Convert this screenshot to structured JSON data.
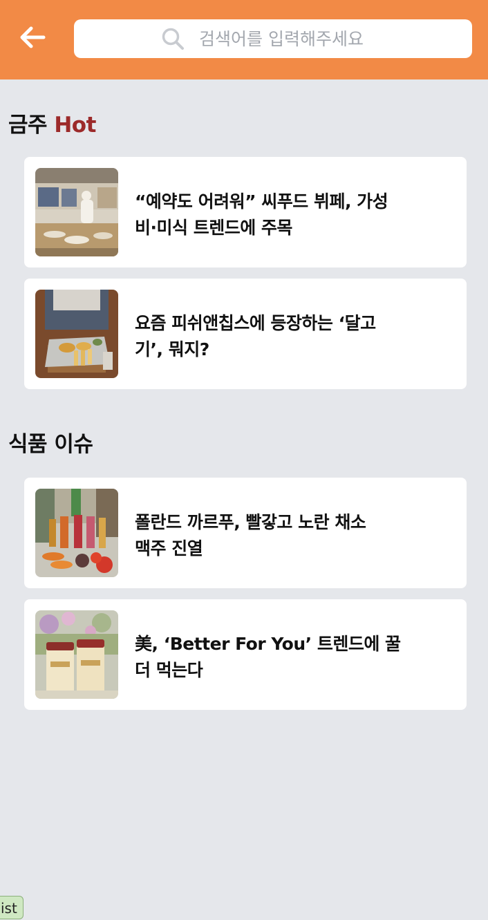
{
  "header": {
    "search_placeholder": "검색어를 입력해주세요",
    "back_icon": "arrow-left-icon",
    "search_icon": "search-icon",
    "background_color": "#f28a46"
  },
  "sections": [
    {
      "title_prefix": "금주 ",
      "title_accent": "Hot",
      "accent_color": "#9c2a2a",
      "articles": [
        {
          "title": "“예약도 어려워” 씨푸드 뷔페, 가성\n비·미식 트렌드에 주목"
        },
        {
          "title": "요즘 피쉬앤칩스에 등장하는 ‘달고\n기’, 뭐지?"
        }
      ]
    },
    {
      "title_prefix": "식품 이슈",
      "articles": [
        {
          "title": "폴란드 까르푸, 빨갛고 노란 채소\n맥주 진열"
        },
        {
          "title": "美, ‘Better For You’ 트렌드에 꿀\n더 먹는다"
        }
      ]
    }
  ],
  "dev_badge": "ist"
}
